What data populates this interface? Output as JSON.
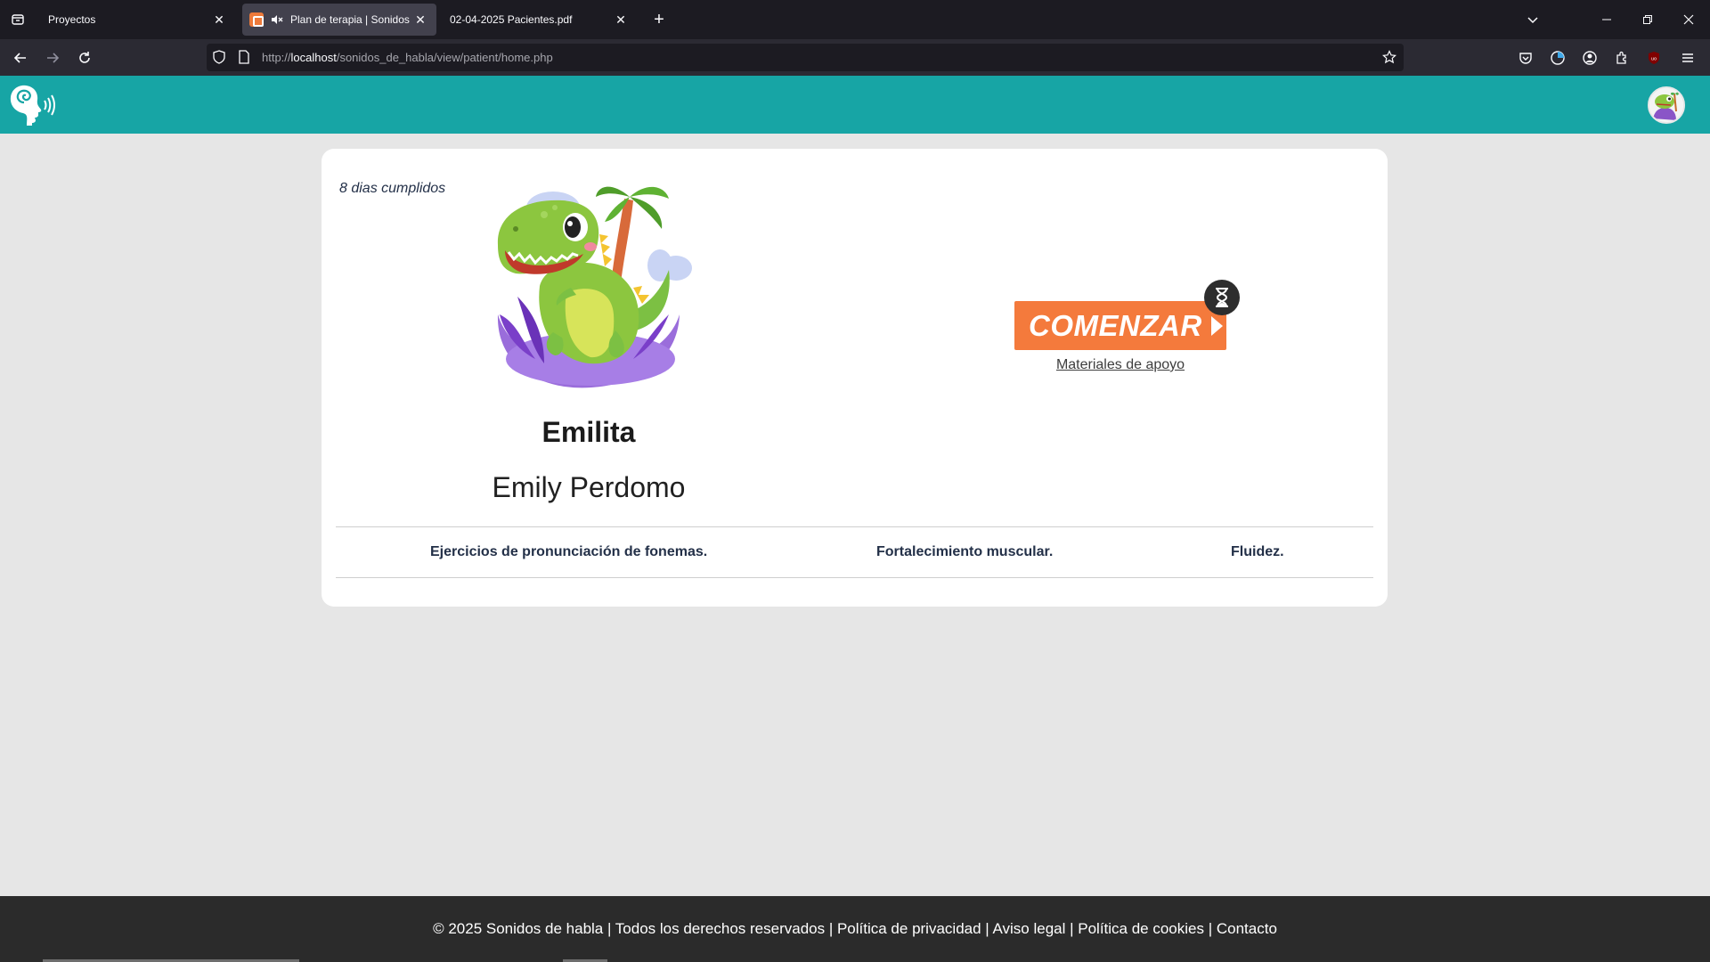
{
  "browser": {
    "tabs": [
      {
        "title": "Proyectos",
        "close": "✕"
      },
      {
        "title": "Plan de terapia | Sonidos de habla",
        "close": "✕"
      },
      {
        "title": "02-04-2025 Pacientes.pdf",
        "close": "✕"
      }
    ],
    "new_tab": "+",
    "url_prefix": "http://",
    "url_host": "localhost",
    "url_path": "/sonidos_de_habla/view/patient/home.php"
  },
  "patient": {
    "days_completed": "8 dias cumplidos",
    "nickname": "Emilita",
    "full_name": "Emily Perdomo"
  },
  "actions": {
    "start_label": "COMENZAR",
    "materials_label": "Materiales de apoyo"
  },
  "exercises": [
    "Ejercicios de pronunciación de fonemas.",
    "Fortalecimiento muscular.",
    "Fluidez."
  ],
  "footer": {
    "text": "© 2025 Sonidos de habla | Todos los derechos reservados | Política de privacidad | Aviso legal | Política de cookies | Contacto"
  },
  "colors": {
    "header": "#17a5a5",
    "start_button": "#f47a3c",
    "footer": "#2b2b2b"
  }
}
